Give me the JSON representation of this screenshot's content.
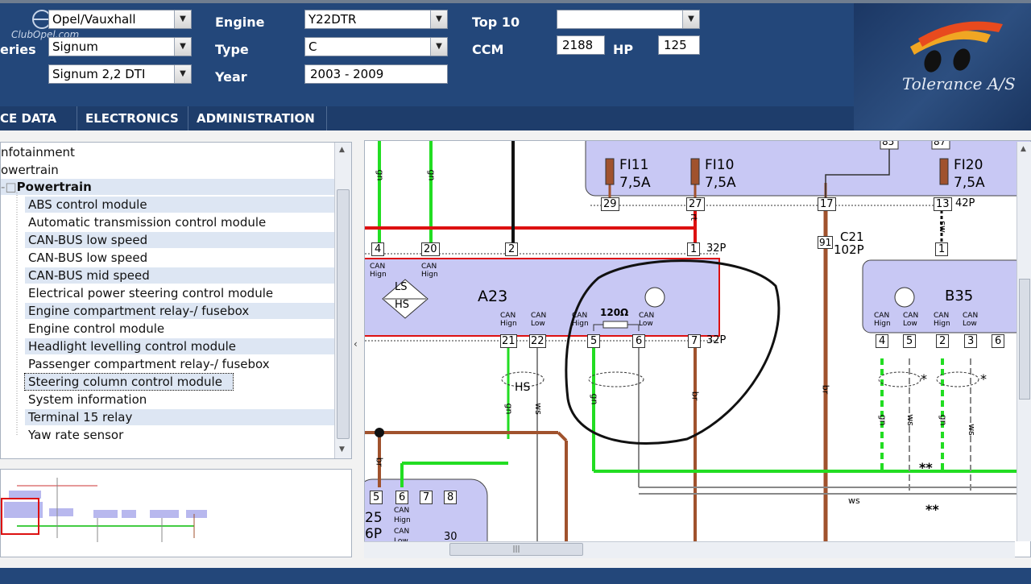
{
  "header": {
    "make": "Opel/Vauxhall",
    "series_label": "eries",
    "series": "Signum",
    "model": "Signum 2,2 DTI",
    "engine_label": "Engine",
    "engine": "Y22DTR",
    "type_label": "Type",
    "type": "C",
    "year_label": "Year",
    "year": "2003 - 2009",
    "top10_label": "Top 10",
    "top10": "",
    "ccm_label": "CCM",
    "ccm": "2188",
    "hp_label": "HP",
    "hp": "125",
    "club_text": "ClubOpel.com",
    "brand": "Tolerance A/S"
  },
  "nav": [
    {
      "label": "CE DATA"
    },
    {
      "label": "ELECTRONICS"
    },
    {
      "label": "ADMINISTRATION"
    }
  ],
  "tree": {
    "top_items": [
      "nfotainment",
      "owertrain"
    ],
    "group": "Powertrain",
    "items": [
      "ABS control module",
      "Automatic transmission control module",
      "CAN-BUS low speed",
      "CAN-BUS low speed",
      "CAN-BUS mid speed",
      "Electrical power steering control module",
      "Engine compartment relay-/ fusebox",
      "Engine control module",
      "Headlight levelling control module",
      "Passenger compartment relay-/ fusebox",
      "Steering column control module",
      "System information",
      "Terminal 15 relay",
      "Yaw rate sensor"
    ],
    "selected_index": 10
  },
  "diagram": {
    "fuses": [
      {
        "name": "FI11",
        "rating": "7,5A"
      },
      {
        "name": "FI10",
        "rating": "7,5A"
      },
      {
        "name": "FI20",
        "rating": "7,5A"
      }
    ],
    "top_pins": [
      "85",
      "87"
    ],
    "connector_42p": [
      "29",
      "27",
      "17",
      "13"
    ],
    "label_42p": "42P",
    "connector_c21": "91",
    "c21_label": "C21",
    "c21_sub": "102P",
    "connector_32p_top": [
      "4",
      "20",
      "2",
      "1"
    ],
    "label_32p": "32P",
    "a23_label": "A23",
    "ls": "LS",
    "hs": "HS",
    "can_high": "CAN\nHign",
    "can_low": "CAN\nLow",
    "resistor": "120Ω",
    "connector_32p_bottom": [
      "21",
      "22",
      "5",
      "6",
      "7"
    ],
    "b35_label": "B35",
    "b35_top_pin": "1",
    "b35_pins": [
      "4",
      "5",
      "2",
      "3",
      "6"
    ],
    "wire_gn": "gn",
    "wire_ws": "ws",
    "wire_br": "br",
    "wire_rt": "rt",
    "wire_sw": "sw",
    "hs_text": "HS",
    "star": "*",
    "double_star": "**",
    "bottom_pins": [
      "5",
      "6",
      "7",
      "8"
    ],
    "bottom_label1": "25",
    "bottom_label2": "6P",
    "bottom_num": "30",
    "bottom_can_high": "CAN",
    "bottom_can_high2": "Hign",
    "bottom_can_low": "CAN",
    "bottom_can_low2": "Low"
  },
  "colors": {
    "header_bg": "#23477a",
    "green_wire": "#22dd22",
    "red_wire": "#dd1111",
    "brown_wire": "#a0522d",
    "module_fill": "#c8c8f4"
  }
}
